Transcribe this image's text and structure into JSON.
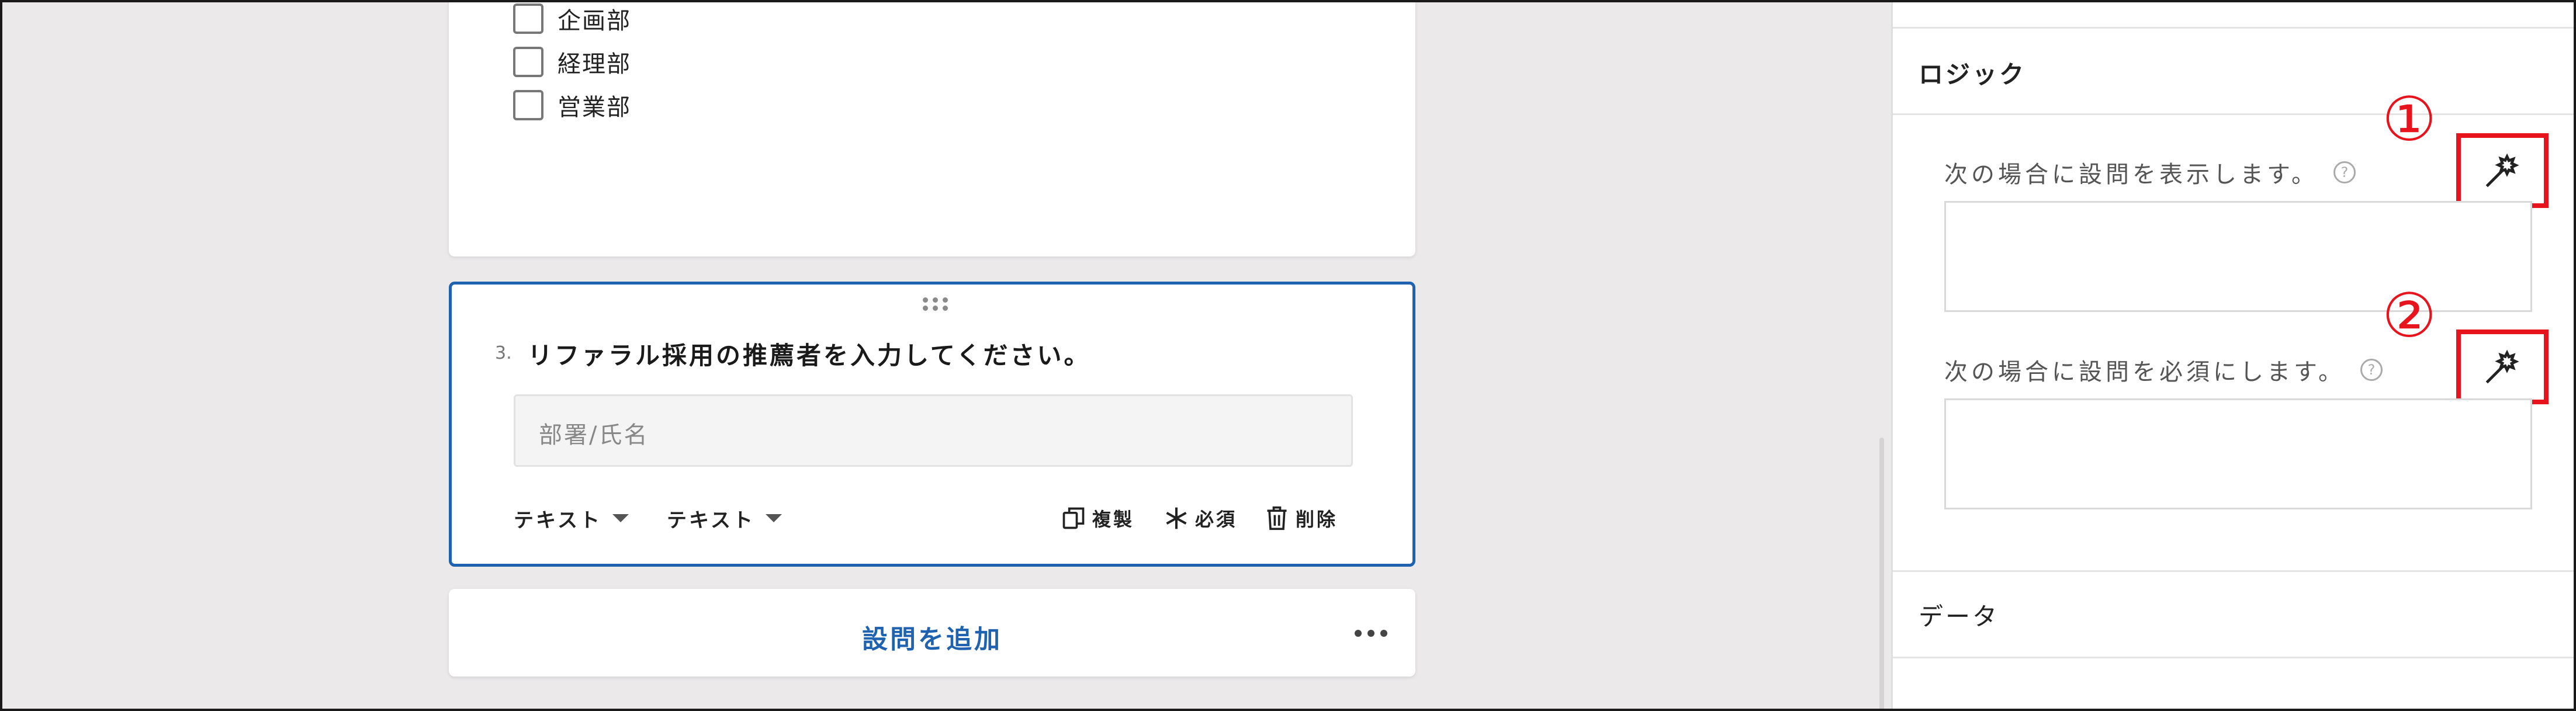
{
  "form": {
    "choices": [
      "企画部",
      "経理部",
      "営業部"
    ],
    "question": {
      "number": "3.",
      "title": "リファラル採用の推薦者を入力してください。",
      "input_placeholder": "部署/氏名",
      "type_dropdown_1": "テキスト",
      "type_dropdown_2": "テキスト",
      "duplicate_label": "複製",
      "required_label": "必須",
      "delete_label": "削除"
    },
    "add_question_label": "設問を追加"
  },
  "panel": {
    "logic_title": "ロジック",
    "show_condition_label": "次の場合に設問を表示します。",
    "required_condition_label": "次の場合に設問を必須にします。",
    "data_title": "データ",
    "help_glyph": "?"
  },
  "annotations": {
    "marker_1": "①",
    "marker_2": "②",
    "highlight_color": "#e8141d"
  },
  "icons": {
    "condition_button": "magic-wand-icon",
    "duplicate": "copy-icon",
    "required": "asterisk-icon",
    "delete": "trash-icon"
  },
  "colors": {
    "accent": "#1f63b0",
    "canvas_bg": "#ebe9ea"
  }
}
